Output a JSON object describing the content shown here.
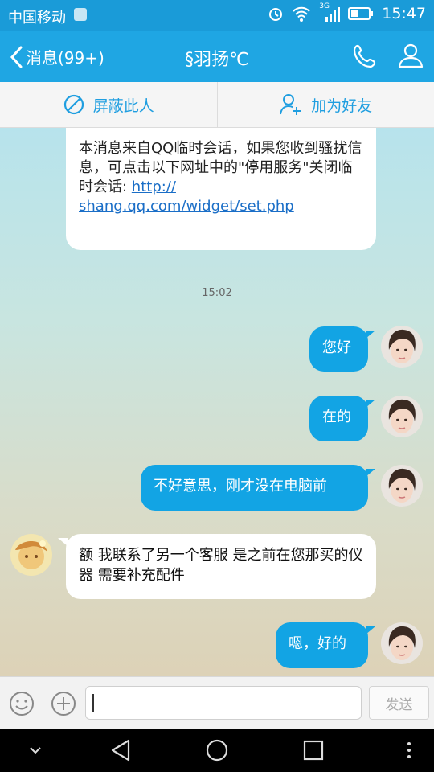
{
  "status_bar": {
    "carrier": "中国移动",
    "network": "3G",
    "time": "15:47"
  },
  "header": {
    "back_label": "消息(99+)",
    "title": "§羽扬℃"
  },
  "actions": {
    "block_label": "屏蔽此人",
    "add_friend_label": "加为好友"
  },
  "system_notice": {
    "text": "本消息来自QQ临时会话，如果您收到骚扰信息，可点击以下网址中的\"停用服务\"关闭临时会话: ",
    "link_part1": "http://",
    "link_part2": "shang.qq.com/widget/set.php"
  },
  "timestamp": "15:02",
  "messages": [
    {
      "dir": "out",
      "text": "您好"
    },
    {
      "dir": "out",
      "text": "在的"
    },
    {
      "dir": "out",
      "text": "不好意思，刚才没在电脑前"
    },
    {
      "dir": "in",
      "text": "额 我联系了另一个客服 是之前在您那买的仪器 需要补充配件"
    },
    {
      "dir": "out",
      "text": "嗯，好的"
    }
  ],
  "input": {
    "value": "",
    "send_label": "发送"
  },
  "colors": {
    "accent": "#1fa6e3",
    "outgoing_bubble": "#12a4e4",
    "incoming_bubble": "#ffffff"
  },
  "icons": [
    "back-chevron-icon",
    "phone-icon",
    "profile-icon",
    "block-icon",
    "add-friend-icon",
    "emoji-icon",
    "plus-icon",
    "nav-back-icon",
    "nav-home-icon",
    "nav-recents-icon",
    "nav-hide-icon",
    "nav-menu-icon"
  ]
}
